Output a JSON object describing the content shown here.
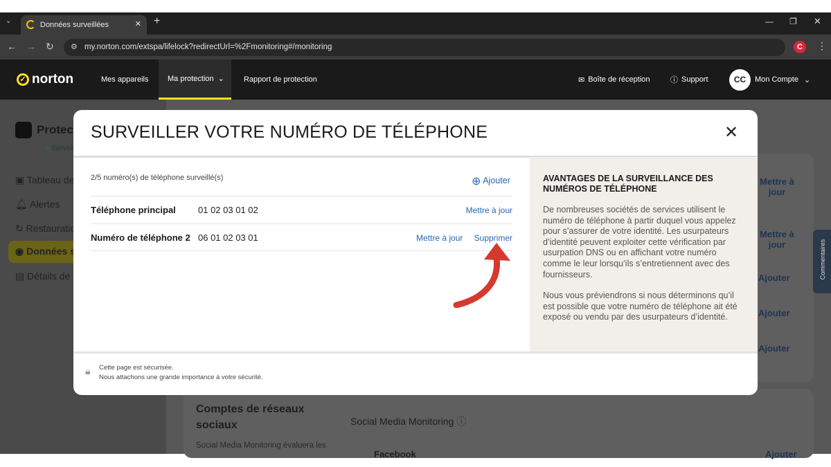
{
  "browser": {
    "tab_title": "Données surveillées",
    "url": "my.norton.com/extspa/lifelock?redirectUrl=%2Fmonitoring#/monitoring",
    "profile_initial": "C"
  },
  "header": {
    "logo": "norton",
    "nav": [
      "Mes appareils",
      "Ma protection",
      "Rapport de protection"
    ],
    "inbox": "Boîte de réception",
    "support": "Support",
    "avatar": "CC",
    "account": "Mon Compte"
  },
  "sidebar": {
    "title": "Protection",
    "status": "Surveillance",
    "items": [
      "Tableau de bord",
      "Alertes",
      "Restauration",
      "Données surveillées",
      "Détails de"
    ]
  },
  "background": {
    "actions": [
      "Mettre à jour",
      "Mettre à jour",
      "Ajouter",
      "Ajouter",
      "Ajouter"
    ],
    "section_title": "Comptes de réseaux sociaux",
    "section_desc": "Social Media Monitoring évaluera les",
    "smm_title": "Social Media Monitoring",
    "facebook": "Facebook",
    "feedback": "Commentaires",
    "bottom_add": "Ajouter"
  },
  "modal": {
    "title": "SURVEILLER VOTRE NUMÉRO DE TÉLÉPHONE",
    "count": "2/5 numéro(s) de téléphone surveillé(s)",
    "add": "Ajouter",
    "rows": [
      {
        "label": "Téléphone principal",
        "number": "01 02 03 01 02",
        "update": "Mettre à jour"
      },
      {
        "label": "Numéro de téléphone 2",
        "number": "06 01 02 03 01",
        "update": "Mettre à jour",
        "delete": "Supprimer"
      }
    ],
    "info_title": "AVANTAGES DE LA SURVEILLANCE DES NUMÉROS DE TÉLÉPHONE",
    "info_p1": "De nombreuses sociétés de services utilisent le numéro de téléphone à partir duquel vous appelez pour s’assurer de votre identité. Les usurpateurs d’identité peuvent exploiter cette vérification par usurpation DNS ou en affichant votre numéro comme le leur lorsqu’ils s’entretiennent avec des fournisseurs.",
    "info_p2": "Nous vous préviendrons si nous déterminons qu’il est possible que votre numéro de téléphone ait été exposé ou vendu par des usurpateurs d’identité.",
    "secure_1": "Cette page est sécurisée.",
    "secure_2": "Nous attachons une grande importance à votre sécurité."
  },
  "colors": {
    "accent": "#ffe01b",
    "link": "#2866b0",
    "arrow": "#d63a2f"
  }
}
